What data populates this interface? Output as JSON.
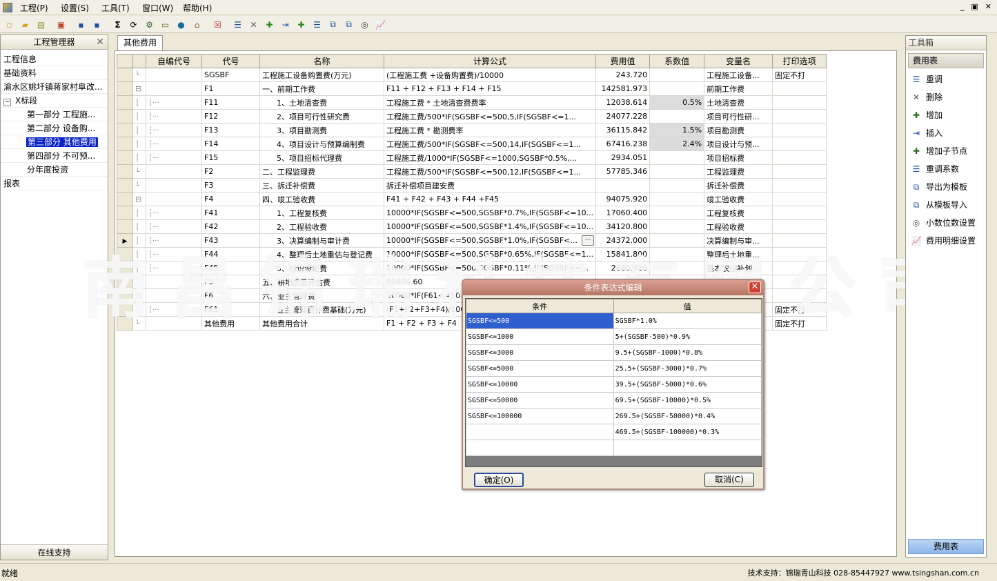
{
  "menu": [
    "工程(P)",
    "设置(S)",
    "工具(T)",
    "窗口(W)",
    "帮助(H)"
  ],
  "window_buttons": [
    "_",
    "▣",
    "✕"
  ],
  "left_panel": {
    "title": "工程管理器",
    "close": "✕",
    "items": [
      "工程信息",
      "基础资料",
      "渝水区姚圩镇蒋家村阜改...",
      "X标段",
      "第一部分 工程施...",
      "第二部分 设备购...",
      "第三部分 其他费用",
      "第四部分 不可预...",
      "分年度投资",
      "报表"
    ],
    "footer": "在线支持"
  },
  "tab_label": "其他费用",
  "grid": {
    "headers": [
      "自编代号",
      "代号",
      "名称",
      "计算公式",
      "费用值",
      "系数值",
      "变量名",
      "打印选项"
    ],
    "rows": [
      {
        "code": "SGSBF",
        "name": "工程施工设备购置费(万元)",
        "formula": "(工程施工费 +设备购置费)/10000",
        "value": "243.720",
        "coef": "",
        "var": "工程施工设备...",
        "print": "固定不打"
      },
      {
        "code": "F1",
        "name": "一、前期工作费",
        "formula": "F11 + F12 + F13 + F14 + F15",
        "value": "142581.973",
        "coef": "",
        "var": "前期工作费",
        "print": ""
      },
      {
        "code": "F11",
        "name": "1、土地清查费",
        "formula": "工程施工费 * 土地清查费费率",
        "value": "12038.614",
        "coef": "0.5%",
        "var": "土地清查费",
        "print": ""
      },
      {
        "code": "F12",
        "name": "2、项目可行性研究费",
        "formula": " 工程施工费/500*IF(SGSBF<=500,5,IF(SGSBF<=1...",
        "value": "24077.228",
        "coef": "",
        "var": "项目可行性研...",
        "print": ""
      },
      {
        "code": "F13",
        "name": "3、项目勘测费",
        "formula": "工程施工费 * 勘测费率",
        "value": "36115.842",
        "coef": "1.5%",
        "var": "项目勘测费",
        "print": ""
      },
      {
        "code": "F14",
        "name": "4、项目设计与预算编制费",
        "formula": "工程施工费/500*IF(SGSBF<=500,14,IF(SGSBF<=1...",
        "value": "67416.238",
        "coef": "2.4%",
        "var": "项目设计与预...",
        "print": ""
      },
      {
        "code": "F15",
        "name": "5、项目招标代理费",
        "formula": " 工程施工费/1000*IF(SGSBF<=1000,SGSBF*0.5%,...",
        "value": "2934.051",
        "coef": "",
        "var": "项目招标费",
        "print": ""
      },
      {
        "code": "F2",
        "name": "二、工程监理费",
        "formula": "工程施工费/500*IF(SGSBF<=500,12,IF(SGSBF<=1...",
        "value": "57785.346",
        "coef": "",
        "var": "工程监理费",
        "print": ""
      },
      {
        "code": "F3",
        "name": "三、拆迁补偿费",
        "formula": "拆迁补偿项目建安费",
        "value": "",
        "coef": "",
        "var": "拆迁补偿费",
        "print": ""
      },
      {
        "code": "F4",
        "name": "四、竣工验收费",
        "formula": "F41 + F42 + F43 + F44 +F45",
        "value": "94075.920",
        "coef": "",
        "var": "竣工验收费",
        "print": ""
      },
      {
        "code": "F41",
        "name": "1、工程复核费",
        "formula": "10000*IF(SGSBF<=500,SGSBF*0.7%,IF(SGSBF<=10...",
        "value": "17060.400",
        "coef": "",
        "var": "工程复核费",
        "print": ""
      },
      {
        "code": "F42",
        "name": "2、工程验收费",
        "formula": "10000*IF(SGSBF<=500,SGSBF*1.4%,IF(SGSBF<=10...",
        "value": "34120.800",
        "coef": "",
        "var": "工程验收费",
        "print": ""
      },
      {
        "code": "F43",
        "name": "3、决算编制与审计费",
        "formula": "10000*IF(SGSBF<=500,SGSBF*1.0%,IF(SGSBF<...",
        "value": "24372.000",
        "coef": "",
        "var": "决算编制与审...",
        "print": ""
      },
      {
        "code": "F44",
        "name": "4、整理后土地重估与登记费",
        "formula": "10000*IF(SGSBF<=500,SGSBF*0.65%,IF(SGSBF<=1...",
        "value": "15841.800",
        "coef": "",
        "var": "整理后土地重...",
        "print": ""
      },
      {
        "code": "F45",
        "name": "5、标识设定费",
        "formula": " 10000*IF(SGSBF<=500,SGSBF*0.11%,IF(SGSBF<=...",
        "value": "2680.920",
        "coef": "",
        "var": "基本农田补划...",
        "print": ""
      },
      {
        "code": "F5",
        "name": "五、耕地质量评估费",
        "formula": "80404.60",
        "value": "",
        "coef": "",
        "var": "",
        "print": ""
      },
      {
        "code": "F6",
        "name": "六、业主管理费",
        "formula": "10000*IF(F61<=500",
        "value": "",
        "coef": "",
        "var": "",
        "print": ""
      },
      {
        "code": "F61",
        "name": "业主管理费计费基础(万元)",
        "formula": "(F1+F2+F3+F4)/10000",
        "value": "",
        "coef": "",
        "var": "",
        "print": "固定不打"
      },
      {
        "code": "其他费用",
        "name": "其他费用合计",
        "formula": "F1 + F2 + F3 + F4",
        "value": "",
        "coef": "",
        "var": "",
        "print": "固定不打"
      }
    ],
    "ellipsis": "···"
  },
  "watermark": "南昌锦瑞科技有限公司",
  "dialog": {
    "title": "条件表达式编辑",
    "close": "✕",
    "col_condition": "条件",
    "col_value": "值",
    "rows": [
      {
        "cond": "SGSBF<=500",
        "val": "SGSBF*1.0%"
      },
      {
        "cond": "SGSBF<=1000",
        "val": "5+(SGSBF-500)*0.9%"
      },
      {
        "cond": "SGSBF<=3000",
        "val": "9.5+(SGSBF-1000)*0.8%"
      },
      {
        "cond": "SGSBF<=5000",
        "val": "25.5+(SGSBF-3000)*0.7%"
      },
      {
        "cond": "SGSBF<=10000",
        "val": "39.5+(SGSBF-5000)*0.6%"
      },
      {
        "cond": "SGSBF<=50000",
        "val": "69.5+(SGSBF-10000)*0.5%"
      },
      {
        "cond": "SGSBF<=100000",
        "val": "269.5+(SGSBF-50000)*0.4%"
      },
      {
        "cond": "",
        "val": "469.5+(SGSBF-100000)*0.3%"
      },
      {
        "cond": "",
        "val": ""
      }
    ],
    "ok": "确定(O)",
    "cancel": "取消(C)"
  },
  "right_panel": {
    "title": "工具箱",
    "section": "费用表",
    "tools": [
      {
        "label": "重调",
        "icon": "list-icon"
      },
      {
        "label": "删除",
        "icon": "delete-icon"
      },
      {
        "label": "增加",
        "icon": "add-icon"
      },
      {
        "label": "插入",
        "icon": "insert-icon"
      },
      {
        "label": "增加子节点",
        "icon": "add-child-icon"
      },
      {
        "label": "重调系数",
        "icon": "list-icon"
      },
      {
        "label": "导出为模板",
        "icon": "export-icon"
      },
      {
        "label": "从模板导入",
        "icon": "import-icon"
      },
      {
        "label": "小数位数设置",
        "icon": "decimal-icon"
      },
      {
        "label": "费用明细设置",
        "icon": "chart-icon"
      }
    ],
    "footer": "费用表"
  },
  "status": {
    "left": "就绪",
    "right": "技术支持：锦瑞青山科技 028-85447927 www.tsingshan.com.cn"
  }
}
